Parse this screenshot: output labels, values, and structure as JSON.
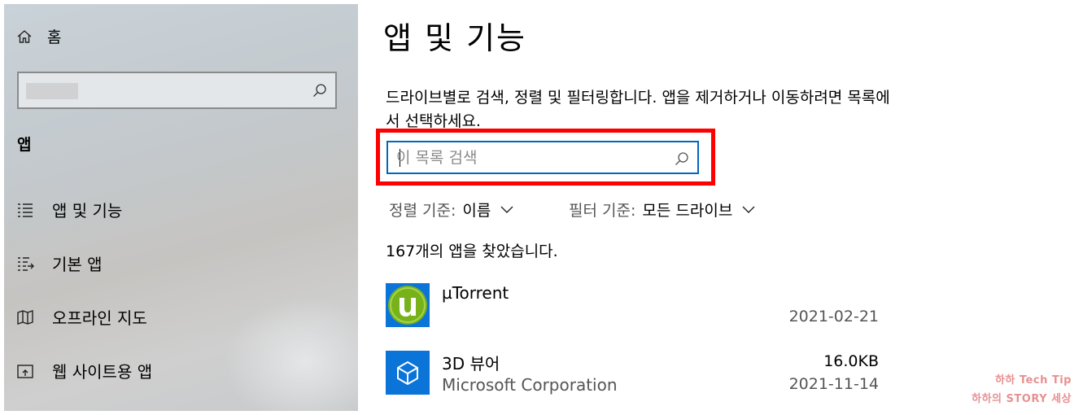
{
  "sidebar": {
    "home_label": "홈",
    "search_placeholder": "",
    "section_label": "앱",
    "items": [
      {
        "label": "앱 및 기능",
        "icon": "apps-features-icon"
      },
      {
        "label": "기본 앱",
        "icon": "default-apps-icon"
      },
      {
        "label": "오프라인 지도",
        "icon": "offline-maps-icon"
      },
      {
        "label": "웹 사이트용 앱",
        "icon": "apps-for-websites-icon"
      }
    ]
  },
  "main": {
    "title": "앱 및 기능",
    "description": "드라이브별로 검색, 정렬 및 필터링합니다. 앱을 제거하거나 이동하려면 목록에서 선택하세요.",
    "search_placeholder": "이 목록 검색",
    "sort": {
      "label": "정렬 기준:",
      "value": "이름"
    },
    "filter": {
      "label": "필터 기준:",
      "value": "모든 드라이브"
    },
    "found_text": "167개의 앱을 찾았습니다.",
    "apps": [
      {
        "name": "µTorrent",
        "publisher": "",
        "size": "",
        "date": "2021-02-21",
        "icon": "utorrent-icon"
      },
      {
        "name": "3D 뷰어",
        "publisher": "Microsoft Corporation",
        "size": "16.0KB",
        "date": "2021-11-14",
        "icon": "3d-viewer-icon"
      }
    ]
  },
  "watermark": {
    "line1": "하하 Tech Tip",
    "line2": "하하의 STORY 세상"
  },
  "colors": {
    "accent": "#0067c0",
    "highlight": "#ff0000",
    "utorrent_green": "#78b21b",
    "viewer_blue": "#0a74d8"
  }
}
